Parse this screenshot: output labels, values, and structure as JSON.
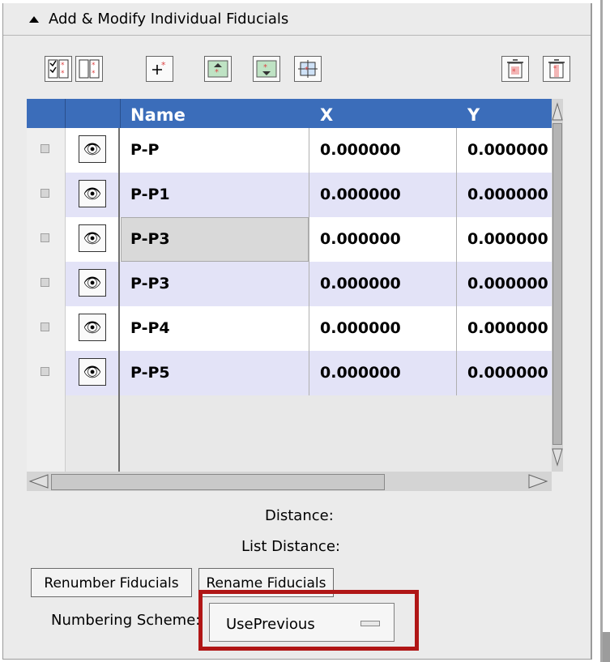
{
  "panel": {
    "title": "Add & Modify Individual Fiducials"
  },
  "toolbar": {
    "buttons": [
      {
        "icon": "select-all-checks-icon"
      },
      {
        "icon": "deselect-all-checks-icon"
      },
      {
        "icon": "add-fiducial-icon"
      },
      {
        "icon": "move-up-icon"
      },
      {
        "icon": "move-down-icon"
      },
      {
        "icon": "transform-icon"
      },
      {
        "icon": "delete-selected-icon"
      },
      {
        "icon": "delete-all-icon"
      }
    ]
  },
  "table": {
    "columns": [
      "",
      "",
      "Name",
      "X",
      "Y"
    ],
    "rows": [
      {
        "name": "P-P",
        "x": "0.000000",
        "y": "0.000000"
      },
      {
        "name": "P-P1",
        "x": "0.000000",
        "y": "0.000000"
      },
      {
        "name": "P-P3",
        "x": "0.000000",
        "y": "0.000000",
        "selected": true
      },
      {
        "name": "P-P3",
        "x": "0.000000",
        "y": "0.000000"
      },
      {
        "name": "P-P4",
        "x": "0.000000",
        "y": "0.000000"
      },
      {
        "name": "P-P5",
        "x": "0.000000",
        "y": "0.000000"
      }
    ],
    "row_icon": "eye-icon"
  },
  "info": {
    "distance_label": "Distance:",
    "list_distance_label": "List Distance:"
  },
  "actions": {
    "renumber_label": "Renumber Fiducials",
    "rename_label": "Rename Fiducials"
  },
  "numbering": {
    "label": "Numbering Scheme:",
    "selected": "UsePrevious"
  },
  "colors": {
    "header_blue": "#3b6dba",
    "highlight_red": "#b01616",
    "alt_row": "#e3e3f7"
  }
}
